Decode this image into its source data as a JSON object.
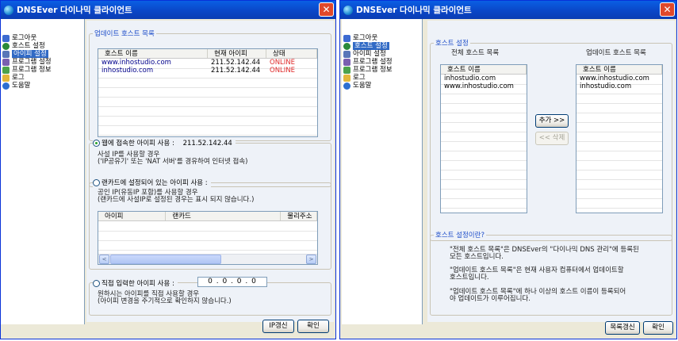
{
  "window1": {
    "title": "DNSEver 다이나믹 클라이언트",
    "close": "✕",
    "nav": [
      {
        "label": "로그아웃",
        "icon": "users-icon",
        "color": "#3d6bd1"
      },
      {
        "label": "호스트 설정",
        "icon": "globe-icon",
        "color": "#2a8a3a"
      },
      {
        "label": "아이피 설정",
        "icon": "monitor-icon",
        "color": "#5876b8"
      },
      {
        "label": "프로그램 설정",
        "icon": "program-settings-icon",
        "color": "#7a5fb0"
      },
      {
        "label": "프로그램 정보",
        "icon": "program-info-icon",
        "color": "#4ca24c"
      },
      {
        "label": "로그",
        "icon": "folder-icon",
        "color": "#e2b73a"
      },
      {
        "label": "도움말",
        "icon": "help-icon",
        "color": "#2c6fd1"
      }
    ],
    "update_hosts": {
      "legend": "업데이트 호스트 목록",
      "columns": [
        "호스트 이름",
        "현재 아이피",
        "상태"
      ],
      "rows": [
        [
          "www.inhostudio.com",
          "211.52.142.44",
          "ONLINE"
        ],
        [
          "inhostudio.com",
          "211.52.142.44",
          "ONLINE"
        ]
      ]
    },
    "web_ip": {
      "label": "웹에 접속한 아이피 사용 :",
      "value": "211.52.142.44",
      "desc1": "사설 IP를 사용할 경우",
      "desc2": "('IP공유기' 또는 'NAT 서버'를 경유하여 인터넷 접속)"
    },
    "lan_ip": {
      "label": "랜카드에 설정되어 있는 아이피 사용 :",
      "desc1": "공인 IP(유동IP 포함)를 사용할 경우",
      "desc2": "(랜카드에 사설IP로 설정된 경우는 표시 되지 않습니다.)",
      "columns": [
        "아이피",
        "랜카드",
        "물리주소"
      ],
      "scroll_left": "<",
      "scroll_right": ">"
    },
    "manual_ip": {
      "label": "직접 입력한 아이피 사용 :",
      "value": "0 . 0 . 0 . 0",
      "desc1": "원하시는 아이피를 직접 사용할 경우",
      "desc2": "(아이피 변경을 주기적으로 확인하지 않습니다.)"
    },
    "buttons": {
      "ip_refresh": "IP갱신",
      "ok": "확인"
    }
  },
  "window2": {
    "title": "DNSEver 다이나믹 클라이언트",
    "close": "✕",
    "nav": [
      {
        "label": "로그아웃",
        "icon": "users-icon",
        "color": "#3d6bd1"
      },
      {
        "label": "호스트 설정",
        "icon": "globe-icon",
        "color": "#2a8a3a"
      },
      {
        "label": "아이피 설정",
        "icon": "monitor-icon",
        "color": "#5876b8"
      },
      {
        "label": "프로그램 설정",
        "icon": "program-settings-icon",
        "color": "#7a5fb0"
      },
      {
        "label": "프로그램 정보",
        "icon": "program-info-icon",
        "color": "#4ca24c"
      },
      {
        "label": "로그",
        "icon": "folder-icon",
        "color": "#e2b73a"
      },
      {
        "label": "도움말",
        "icon": "help-icon",
        "color": "#2c6fd1"
      }
    ],
    "host_settings": {
      "legend": "호스트 설정",
      "all_title": "전체 호스트 목록",
      "update_title": "업데이트 호스트 목록",
      "col_header": "호스트 이름",
      "all_hosts": [
        "inhostudio.com",
        "www.inhostudio.com"
      ],
      "update_hosts": [
        "www.inhostudio.com",
        "inhostudio.com"
      ],
      "add_button": "추가 >>",
      "delete_button": "<< 삭제"
    },
    "about": {
      "legend": "호스트 설정이란?",
      "p1a": "\"전체 호스트 목록\"은 DNSEver의 \"다이나믹 DNS 관리\"에 등록된",
      "p1b": "모든 호스트입니다.",
      "p2a": "\"업데이트 호스트 목록\"은 현재 사용자 컴퓨터에서 업데이트할",
      "p2b": "호스트입니다.",
      "p3a": "\"업데이트 호스트 목록\"에 하나 이상의 호스트 이름이 등록되어",
      "p3b": "야 업데이트가 이루어집니다."
    },
    "buttons": {
      "list_refresh": "목록갱신",
      "ok": "확인"
    }
  }
}
